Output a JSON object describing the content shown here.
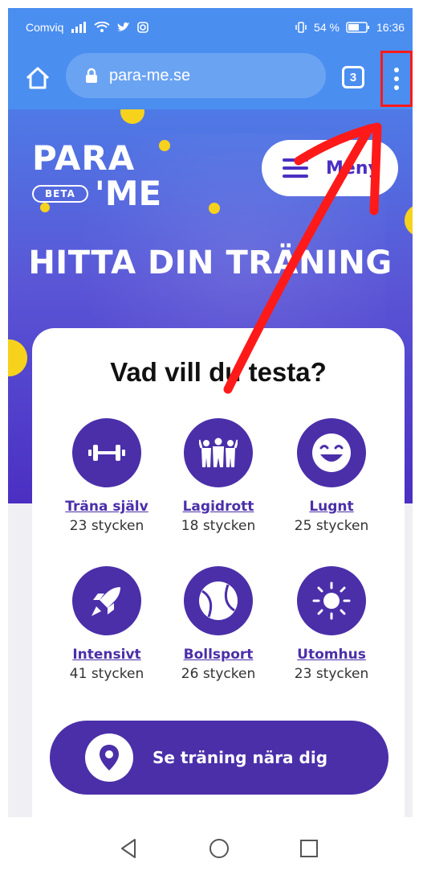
{
  "status": {
    "carrier": "Comviq",
    "battery": "54 %",
    "time": "16:36"
  },
  "browser": {
    "url": "para-me.se",
    "tab_count": "3"
  },
  "site": {
    "logo": {
      "line1": "PARA",
      "beta": "BETA",
      "line2": "'ME"
    },
    "menu_label": "Meny",
    "hero_title": "HITTA DIN TRÄNING",
    "card_title": "Vad vill du testa?",
    "categories": [
      {
        "name": "Träna själv",
        "count": "23 stycken",
        "icon": "dumbbell-icon"
      },
      {
        "name": "Lagidrott",
        "count": "18 stycken",
        "icon": "team-icon"
      },
      {
        "name": "Lugnt",
        "count": "25 stycken",
        "icon": "smiley-icon"
      },
      {
        "name": "Intensivt",
        "count": "41 stycken",
        "icon": "rocket-icon"
      },
      {
        "name": "Bollsport",
        "count": "26 stycken",
        "icon": "ball-icon"
      },
      {
        "name": "Utomhus",
        "count": "23 stycken",
        "icon": "sun-icon"
      }
    ],
    "cta_label": "Se träning nära dig"
  },
  "colors": {
    "browser_bar": "#4a8ef0",
    "brand_purple": "#4b2fa9",
    "accent_yellow": "#f6d21d",
    "annotation_red": "#ff1a1a"
  }
}
